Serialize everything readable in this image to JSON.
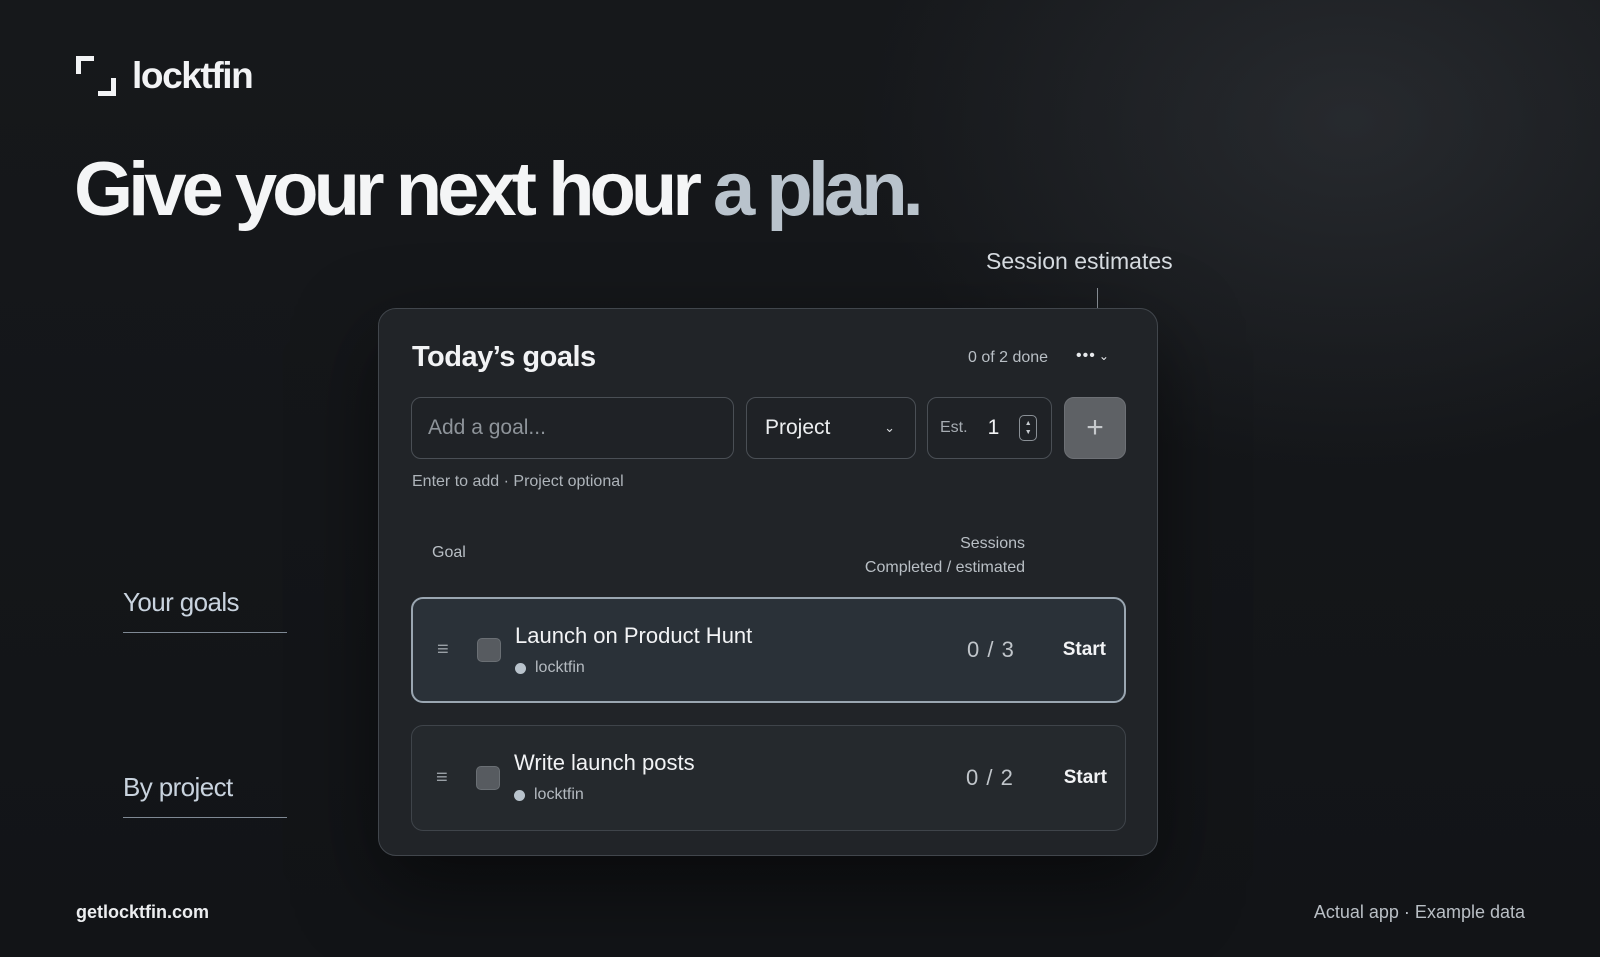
{
  "brand": {
    "name": "locktfin",
    "mark_icon": "corner-brackets-icon"
  },
  "headline": {
    "main": "Give your next hour",
    "accent": "a plan."
  },
  "callouts": {
    "session_estimates": "Session estimates"
  },
  "side_labels": {
    "your_goals": "Your goals",
    "by_project": "By project"
  },
  "goals_card": {
    "title": "Today’s goals",
    "done_count": "0 of 2 done",
    "menu_icon": "ellipsis-icon",
    "input": {
      "placeholder": "Add a goal...",
      "value": ""
    },
    "project_select": {
      "selected": "Project",
      "icon": "chevron-down-icon"
    },
    "estimate": {
      "label": "Est.",
      "value": "1",
      "icon": "stepper-icon"
    },
    "add_icon": "plus-icon",
    "hint": "Enter to add · Project optional",
    "columns": {
      "goal": "Goal",
      "sessions_line1": "Sessions",
      "sessions_line2": "Completed / estimated"
    },
    "rows": [
      {
        "title": "Launch on Product Hunt",
        "project": "locktfin",
        "sessions": "0 / 3",
        "action": "Start",
        "active": true
      },
      {
        "title": "Write launch posts",
        "project": "locktfin",
        "sessions": "0 / 2",
        "action": "Start",
        "active": false
      }
    ]
  },
  "footer": {
    "url": "getlocktfin.com",
    "note": "Actual app · Example data"
  },
  "colors": {
    "background": "#121417",
    "card": "#212428",
    "accent": "#b9c3cc",
    "text": "#f2f3f5"
  }
}
